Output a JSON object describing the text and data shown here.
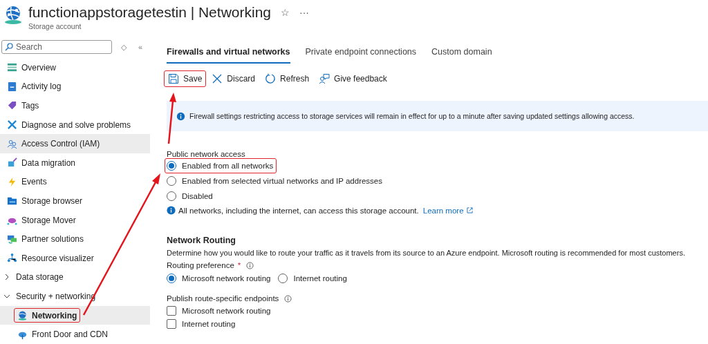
{
  "header": {
    "title": "functionappstoragetestin | Networking",
    "subtitle": "Storage account",
    "favorite_glyph": "☆",
    "more_glyph": "···"
  },
  "sidebar": {
    "search": {
      "placeholder": "Search"
    },
    "sort_glyph": "◇",
    "collapse_glyph": "«",
    "items": [
      {
        "kind": "item",
        "label": "Overview",
        "selected": false,
        "hovered": false
      },
      {
        "kind": "item",
        "label": "Activity log",
        "selected": false,
        "hovered": false
      },
      {
        "kind": "item",
        "label": "Tags",
        "selected": false,
        "hovered": false
      },
      {
        "kind": "item",
        "label": "Diagnose and solve problems",
        "selected": false,
        "hovered": false
      },
      {
        "kind": "item",
        "label": "Access Control (IAM)",
        "selected": false,
        "hovered": true
      },
      {
        "kind": "item",
        "label": "Data migration",
        "selected": false,
        "hovered": false
      },
      {
        "kind": "item",
        "label": "Events",
        "selected": false,
        "hovered": false
      },
      {
        "kind": "item",
        "label": "Storage browser",
        "selected": false,
        "hovered": false
      },
      {
        "kind": "item",
        "label": "Storage Mover",
        "selected": false,
        "hovered": false
      },
      {
        "kind": "item",
        "label": "Partner solutions",
        "selected": false,
        "hovered": false
      },
      {
        "kind": "item",
        "label": "Resource visualizer",
        "selected": false,
        "hovered": false
      },
      {
        "kind": "group",
        "label": "Data storage",
        "expanded": false
      },
      {
        "kind": "group",
        "label": "Security + networking",
        "expanded": true,
        "children": [
          {
            "kind": "item",
            "label": "Networking",
            "selected": true,
            "hovered": false,
            "highlighted": true
          },
          {
            "kind": "item",
            "label": "Front Door and CDN",
            "selected": false,
            "hovered": false
          }
        ]
      }
    ]
  },
  "tabs": [
    {
      "label": "Firewalls and virtual networks",
      "selected": true
    },
    {
      "label": "Private endpoint connections",
      "selected": false
    },
    {
      "label": "Custom domain",
      "selected": false
    }
  ],
  "toolbar": [
    {
      "label": "Save",
      "highlighted": true
    },
    {
      "label": "Discard",
      "highlighted": false
    },
    {
      "label": "Refresh",
      "highlighted": false
    },
    {
      "label": "Give feedback",
      "highlighted": false
    }
  ],
  "info_banner": "Firewall settings restricting access to storage services will remain in effect for up to a minute after saving updated settings allowing access.",
  "public_access": {
    "label": "Public network access",
    "options": [
      {
        "label": "Enabled from all networks",
        "selected": true,
        "highlighted": true
      },
      {
        "label": "Enabled from selected virtual networks and IP addresses",
        "selected": false,
        "highlighted": false
      },
      {
        "label": "Disabled",
        "selected": false,
        "highlighted": false
      }
    ],
    "note": "All networks, including the internet, can access this storage account.",
    "link": "Learn more"
  },
  "routing": {
    "heading": "Network Routing",
    "description": "Determine how you would like to route your traffic as it travels from its source to an Azure endpoint. Microsoft routing is recommended for most customers.",
    "preference_label": "Routing preference",
    "required_mark": "*",
    "preference_options": [
      {
        "label": "Microsoft network routing",
        "selected": true
      },
      {
        "label": "Internet routing",
        "selected": false
      }
    ],
    "publish_label": "Publish route-specific endpoints",
    "publish_options": [
      {
        "label": "Microsoft network routing",
        "checked": false
      },
      {
        "label": "Internet routing",
        "checked": false
      }
    ]
  }
}
